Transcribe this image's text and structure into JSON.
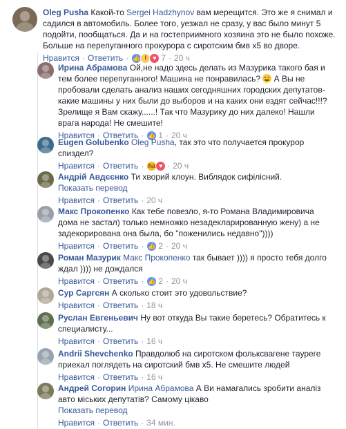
{
  "labels": {
    "like": "Нравится",
    "reply": "Ответить",
    "sep": "·"
  },
  "colors": {
    "link": "#385898",
    "meta": "#90949c",
    "text": "#1d2129",
    "like_badge": "#5890ff"
  },
  "comments": [
    {
      "author": "Oleg Pusha",
      "avatar_color": "#7b6a55",
      "segments": [
        {
          "text": " Какой-то "
        },
        {
          "tag": "Sergei Hadzhynov"
        },
        {
          "text": " вам мерещится. Это же я снимал и садился в автомобиль. Более того, уезжал не сразу, у вас было минут 5 подойти, пообщаться. Да и на гостеприимного хозяина это не было похоже. Больше на перепуганного прокурора с сиротским бмв х5 во дворе."
        }
      ],
      "reactions": [
        "like",
        "wow",
        "love"
      ],
      "reaction_count": "7",
      "time": "20 ч"
    },
    {
      "author": "Ирина Абрамова",
      "avatar_color": "#8a6d6d",
      "segments": [
        {
          "text": " Ой,не надо здесь делать из Мазурика такого бая и тем более перепуганного! Машина не понравилась? "
        },
        {
          "emoji": "smile"
        },
        {
          "text": " А Вы не пробовали сделать анализ наших сегодняшних городских депутатов- какие машины у них были до выборов и на каких они ездят сейчас!!!? Зрелище я Вам скажу......! Так что Мазурику до них далеко! Нашли врага народа! Не смешите!"
        }
      ],
      "reactions": [
        "like"
      ],
      "reaction_count": "1",
      "time": "20 ч"
    },
    {
      "author": "Eugen Golubenko",
      "avatar_color": "#3f6b8a",
      "segments": [
        {
          "text": " "
        },
        {
          "tag": "Oleg Pusha"
        },
        {
          "text": ", так это что получается прокурор спиздел?"
        }
      ],
      "reactions": [
        "haha",
        "love"
      ],
      "reaction_count": "",
      "time": "20 ч"
    },
    {
      "author": "Андрій Авдєєнко",
      "avatar_color": "#6b6b4a",
      "segments": [
        {
          "text": " Ти хворий клоун. Виблядок сифілісний."
        }
      ],
      "translate": "Показать перевод",
      "reactions": [],
      "reaction_count": "",
      "time": "20 ч"
    },
    {
      "author": "Макс Прокопенко",
      "avatar_color": "#9a9fa8",
      "segments": [
        {
          "text": " Как тебе повезло, я-то Романа Владимировича дома не застал) только немножко незадекларированную жену) а не задекорирована она была, бо \"поженились недавно\"))))"
        }
      ],
      "reactions": [
        "like"
      ],
      "reaction_count": "2",
      "time": "20 ч"
    },
    {
      "author": "Роман Мазурик",
      "avatar_color": "#4a4a4a",
      "segments": [
        {
          "text": " "
        },
        {
          "tag": "Макс Прокопенко"
        },
        {
          "text": " так бывает )))) я просто тебя долго ждал )))) не дождался"
        }
      ],
      "reactions": [
        "like"
      ],
      "reaction_count": "2",
      "time": "20 ч"
    },
    {
      "author": "Сур Саргсян",
      "avatar_color": "#b0a898",
      "segments": [
        {
          "text": " А сколько стоит это удовольствие?"
        }
      ],
      "reactions": [],
      "reaction_count": "",
      "time": "18 ч"
    },
    {
      "author": "Руслан Евгеньевич",
      "avatar_color": "#5e6e4e",
      "segments": [
        {
          "text": " Ну вот откуда Вы такие беретесь? Обратитесь к специалисту..."
        }
      ],
      "reactions": [],
      "reaction_count": "",
      "time": "16 ч"
    },
    {
      "author": "Andrii Shevchenko",
      "avatar_color": "#9aa4b0",
      "segments": [
        {
          "text": " Правдолюб на сиротском фольксвагене тауреге приехал поглядеть на сиротский бмв х5. Не смешите людей"
        }
      ],
      "reactions": [],
      "reaction_count": "",
      "time": "16 ч"
    },
    {
      "author": "Андрей Согорин",
      "avatar_color": "#7a7a5a",
      "segments": [
        {
          "text": " "
        },
        {
          "tag": "Ирина Абрамова"
        },
        {
          "text": " А Ви намагались зробити аналіз авто міських депутатів? Самому цікаво"
        }
      ],
      "translate": "Показать перевод",
      "reactions": [],
      "reaction_count": "",
      "time": "34 мин."
    }
  ]
}
